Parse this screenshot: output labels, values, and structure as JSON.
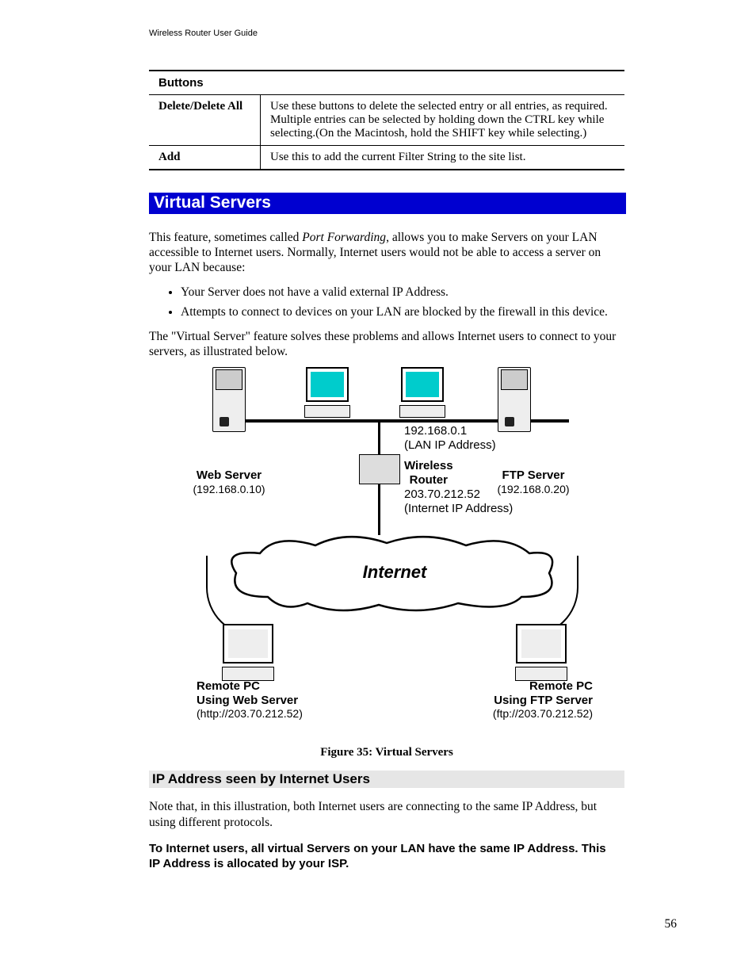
{
  "header": "Wireless Router User Guide",
  "table": {
    "title": "Buttons",
    "rows": [
      {
        "label": "Delete/Delete All",
        "desc": "Use these buttons to delete the selected entry or all entries, as required. Multiple entries can be selected by holding down the CTRL key while selecting.(On the Macintosh, hold the SHIFT key while selecting.)"
      },
      {
        "label": "Add",
        "desc": "Use this to add the current Filter String to the site list."
      }
    ]
  },
  "section_title": "Virtual Servers",
  "intro_before_italic": "This feature, sometimes called ",
  "intro_italic": "Port Forwarding",
  "intro_after_italic": ", allows you to make Servers on your LAN accessible to Internet users. Normally, Internet users would not be able to access a server on your LAN because:",
  "bullets": [
    "Your Server does not have a valid external IP Address.",
    "Attempts to connect to devices on your LAN are blocked by the firewall in this device."
  ],
  "post_bullets": "The \"Virtual Server\" feature solves these problems and allows Internet users to connect to your servers, as illustrated below.",
  "figure": {
    "lan_ip_line1": "192.168.0.1",
    "lan_ip_line2": "(LAN IP Address)",
    "web_server_title": "Web Server",
    "web_server_ip": "(192.168.0.10)",
    "wireless_router_l1": "Wireless",
    "wireless_router_l2": "Router",
    "internet_ip_line1": "203.70.212.52",
    "internet_ip_line2": "(Internet IP Address)",
    "ftp_server_title": "FTP Server",
    "ftp_server_ip": "(192.168.0.20)",
    "cloud_text": "Internet",
    "remote_left_l1": "Remote PC",
    "remote_left_l2": "Using Web Server",
    "remote_left_l3": "(http://203.70.212.52)",
    "remote_right_l1": "Remote PC",
    "remote_right_l2": "Using FTP Server",
    "remote_right_l3": "(ftp://203.70.212.52)",
    "caption": "Figure 35: Virtual Servers"
  },
  "subheading": "IP Address seen by Internet Users",
  "note_para": "Note that, in this illustration, both Internet users are connecting to the same IP Address, but using different protocols.",
  "bold_para": "To Internet users, all virtual Servers on your LAN have the same IP Address. This IP Address is allocated by your ISP.",
  "page_number": "56"
}
